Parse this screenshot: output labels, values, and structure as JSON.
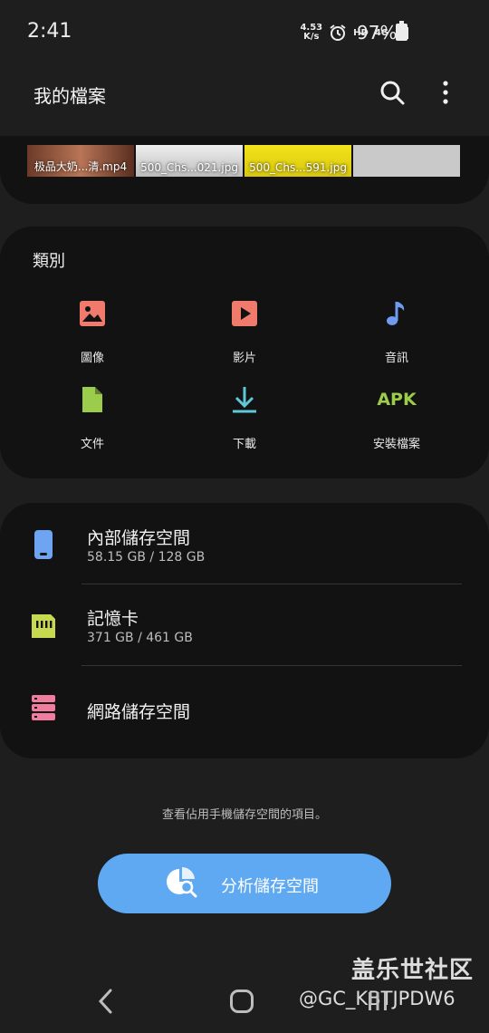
{
  "status_bar": {
    "time": "2:41",
    "net_speed_value": "4.53",
    "net_speed_unit": "K/s",
    "hd": "HD",
    "network": "4G",
    "battery": "97%"
  },
  "header": {
    "title": "我的檔案",
    "search_icon": "search-icon",
    "more_icon": "more-vert-icon"
  },
  "recent_files": [
    {
      "name": "极品大奶...清.mp4",
      "color": "#9b5a3c"
    },
    {
      "name": "500_Chs...021.jpg",
      "color": "#cfcfcf"
    },
    {
      "name": "500_Chs...591.jpg",
      "color": "#e6d914"
    },
    {
      "name": "",
      "color": "#c9c9c9"
    }
  ],
  "categories": {
    "title": "類別",
    "items": [
      {
        "label": "圖像",
        "icon": "image-icon",
        "color": "#f07a6b"
      },
      {
        "label": "影片",
        "icon": "video-icon",
        "color": "#f07a6b"
      },
      {
        "label": "音訊",
        "icon": "music-note-icon",
        "color": "#6f9cf0"
      },
      {
        "label": "文件",
        "icon": "document-icon",
        "color": "#9ccc4c"
      },
      {
        "label": "下載",
        "icon": "download-icon",
        "color": "#5fc7d6"
      },
      {
        "label": "安裝檔案",
        "icon": "apk-icon",
        "icon_text": "APK",
        "color": "#9ccc4c"
      }
    ]
  },
  "storage": {
    "items": [
      {
        "name": "內部儲存空間",
        "size": "58.15 GB / 128 GB",
        "icon": "phone-icon",
        "color": "#6ea5f3"
      },
      {
        "name": "記憶卡",
        "size": "371 GB / 461 GB",
        "icon": "sd-card-icon",
        "color": "#c7d94e"
      },
      {
        "name": "網路儲存空間",
        "size": "",
        "icon": "server-icon",
        "color": "#f07ca0"
      }
    ]
  },
  "hint": "查看佔用手機儲存空間的項目。",
  "analyze_button": {
    "label": "分析儲存空間",
    "icon": "analyze-storage-icon",
    "color": "#5ea9f2"
  },
  "watermark": {
    "line1": "盖乐世社区",
    "line2": "@GC_KBTJPDW6"
  },
  "nav": {
    "back_icon": "back-icon",
    "home_icon": "home-icon",
    "recents_icon": "recents-icon"
  }
}
